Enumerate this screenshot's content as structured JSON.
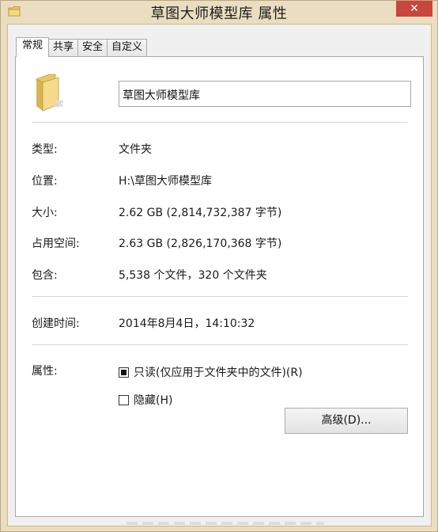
{
  "window": {
    "title": "草图大师模型库 属性",
    "close_label": "✕"
  },
  "tabs": [
    {
      "label": "常规",
      "active": true
    },
    {
      "label": "共享",
      "active": false
    },
    {
      "label": "安全",
      "active": false
    },
    {
      "label": "自定义",
      "active": false
    }
  ],
  "general": {
    "folder_name": "草图大师模型库",
    "type_label": "类型:",
    "type_value": "文件夹",
    "location_label": "位置:",
    "location_value": "H:\\草图大师模型库",
    "size_label": "大小:",
    "size_value": "2.62 GB (2,814,732,387 字节)",
    "disk_size_label": "占用空间:",
    "disk_size_value": "2.63 GB (2,826,170,368 字节)",
    "contains_label": "包含:",
    "contains_value": "5,538 个文件，320 个文件夹",
    "created_label": "创建时间:",
    "created_value": "2014年8月4日，14:10:32",
    "attributes_label": "属性:",
    "readonly_label": "只读(仅应用于文件夹中的文件)(R)",
    "readonly_state": "indeterminate",
    "hidden_label": "隐藏(H)",
    "hidden_checked": false,
    "advanced_button": "高级(D)..."
  },
  "icons": {
    "title_icon": "folder-icon",
    "large_icon": "folder-icon"
  },
  "colors": {
    "frame": "#eaddc0",
    "close": "#c7463d"
  }
}
